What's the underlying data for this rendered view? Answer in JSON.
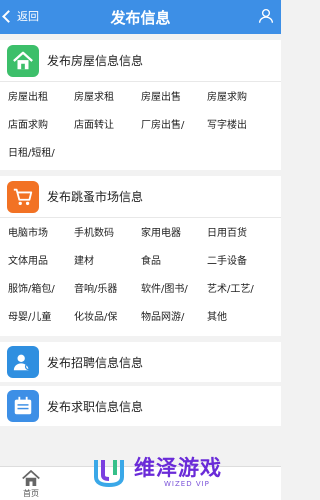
{
  "header": {
    "back_label": "返回",
    "title": "发布信息"
  },
  "sections": [
    {
      "title": "发布房屋信息信息",
      "icon": "house-icon",
      "color": "#3cbf6a",
      "items": [
        "房屋出租",
        "房屋求租",
        "房屋出售",
        "房屋求购",
        "店面求购",
        "店面转让",
        "厂房出售/",
        "写字楼出",
        "日租/短租/"
      ]
    },
    {
      "title": "发布跳蚤市场信息",
      "icon": "cart-icon",
      "color": "#f27224",
      "items": [
        "电脑市场",
        "手机数码",
        "家用电器",
        "日用百货",
        "文体用品",
        "建材",
        "食品",
        "二手设备",
        "服饰/箱包/",
        "音响/乐器",
        "软件/图书/",
        "艺术/工艺/",
        "母婴/儿童",
        "化妆品/保",
        "物品网游/",
        "其他"
      ]
    },
    {
      "title": "发布招聘信息信息",
      "icon": "person-icon",
      "color": "#2f8fe0"
    },
    {
      "title": "发布求职信息信息",
      "icon": "calendar-icon",
      "color": "#3d8fe6"
    }
  ],
  "bottom_nav": {
    "home_label": "首页"
  },
  "watermark": {
    "name": "维泽游戏",
    "sub": "WIZED VIP"
  }
}
